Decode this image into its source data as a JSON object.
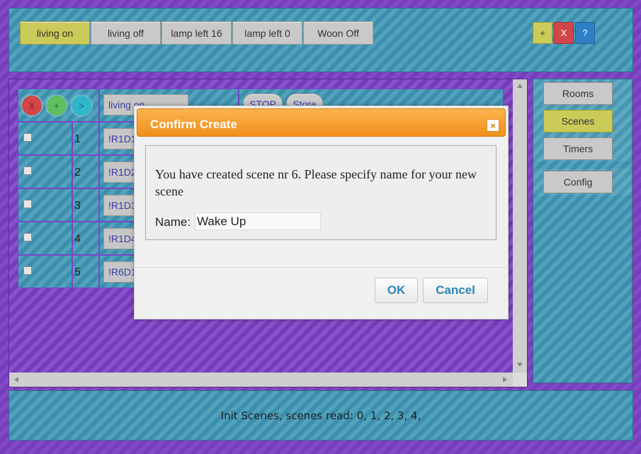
{
  "top_bar": {
    "scene_buttons": [
      "living on",
      "living off",
      "lamp left 16",
      "lamp left 0",
      "Woon Off"
    ],
    "add_label": "+",
    "delete_label": "X",
    "help_label": "?"
  },
  "scene_editor": {
    "round_buttons": [
      "X",
      "+",
      ">"
    ],
    "scene_name_value": "living on",
    "stop_label": "STOP",
    "store_label": "Store",
    "rows": [
      {
        "num": "1",
        "cmd": "!R1D1F"
      },
      {
        "num": "2",
        "cmd": "!R1D2F"
      },
      {
        "num": "3",
        "cmd": "!R1D3F"
      },
      {
        "num": "4",
        "cmd": "!R1D4F"
      },
      {
        "num": "5",
        "cmd": "!R6D1F"
      }
    ]
  },
  "sidebar": {
    "items": [
      "Rooms",
      "Scenes",
      "Timers",
      "Config"
    ],
    "active": "Scenes"
  },
  "status": {
    "text": "Init Scenes, scenes read: 0, 1, 2, 3, 4,"
  },
  "dialog": {
    "title": "Confirm Create",
    "close_label": "×",
    "message": "You have created scene nr 6. Please specify name for your new scene",
    "name_label": "Name:",
    "name_value": "Wake Up",
    "ok_label": "OK",
    "cancel_label": "Cancel"
  },
  "colors": {
    "background_purple": "#7b3fc4",
    "panel_blue": "#3f97b5",
    "active_yellow": "#cbcb59",
    "dialog_orange": "#f39c28",
    "dialog_button_text": "#2a86b8"
  }
}
